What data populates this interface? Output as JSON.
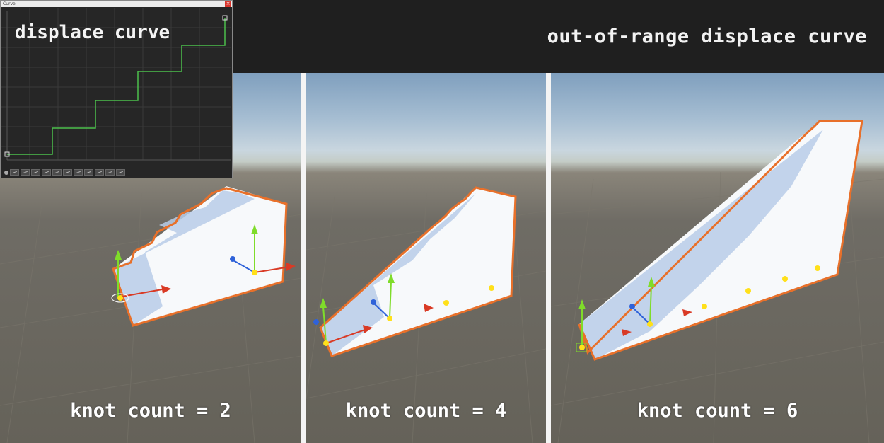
{
  "banner": {
    "title": "out-of-range displace curve"
  },
  "curve_window": {
    "title": "Curve",
    "close_label": "×",
    "heading": "displace curve"
  },
  "panels": [
    {
      "label": "knot count = 2"
    },
    {
      "label": "knot count = 4"
    },
    {
      "label": "knot count = 6"
    }
  ],
  "colors": {
    "curve_line": "#4cbf4c",
    "outline": "#e8702a",
    "gizmo_up": "#7fdc2a",
    "gizmo_forward": "#2f62d9",
    "gizmo_right": "#d93a25",
    "knot": "#ffe01a"
  }
}
